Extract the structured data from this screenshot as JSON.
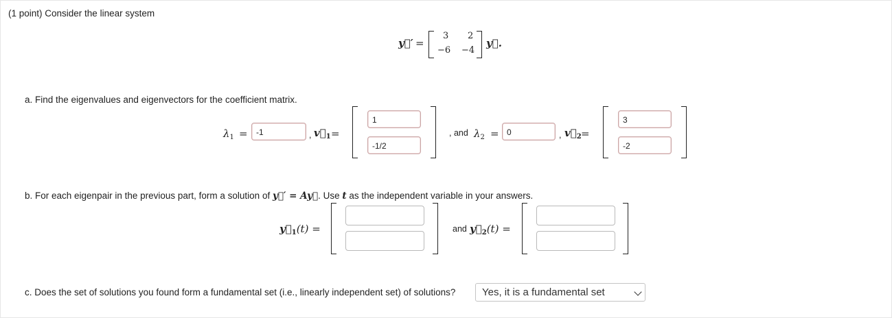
{
  "intro": "(1 point) Consider the linear system",
  "system": {
    "lhs": "y⃗′",
    "eq": "=",
    "matrix": [
      [
        "3",
        "2"
      ],
      [
        "−6",
        "−4"
      ]
    ],
    "rhs": "y⃗."
  },
  "part_a": {
    "prompt": "a. Find the eigenvalues and eigenvectors for the coefficient matrix.",
    "lambda1_label": "λ",
    "lambda1_sub": "1",
    "eq": "=",
    "lambda1_value": "-1",
    "v1_prefix": ",",
    "v1_label": "v⃗",
    "v1_sub": "1",
    "v1_entries": [
      "1",
      "-1/2"
    ],
    "and_text": ", and",
    "lambda2_label": "λ",
    "lambda2_sub": "2",
    "lambda2_value": "0",
    "v2_prefix": ",",
    "v2_label": "v⃗",
    "v2_sub": "2",
    "v2_entries": [
      "3",
      "-2"
    ]
  },
  "part_b": {
    "prompt_start": "b. For each eigenpair in the previous part, form a solution of",
    "prompt_math": "y⃗′ = Ay⃗",
    "prompt_mid": ". Use",
    "prompt_t": "t",
    "prompt_end": "as the independent variable in your answers.",
    "y1_label": "y⃗",
    "y1_sub": "1",
    "y1_arg": "(t) =",
    "and_text": "and",
    "y2_label": "y⃗",
    "y2_sub": "2",
    "y2_arg": "(t) ="
  },
  "part_c": {
    "prompt": "c. Does the set of solutions you found form a fundamental set (i.e., linearly independent set) of solutions?",
    "selected": "Yes, it is a fundamental set"
  }
}
